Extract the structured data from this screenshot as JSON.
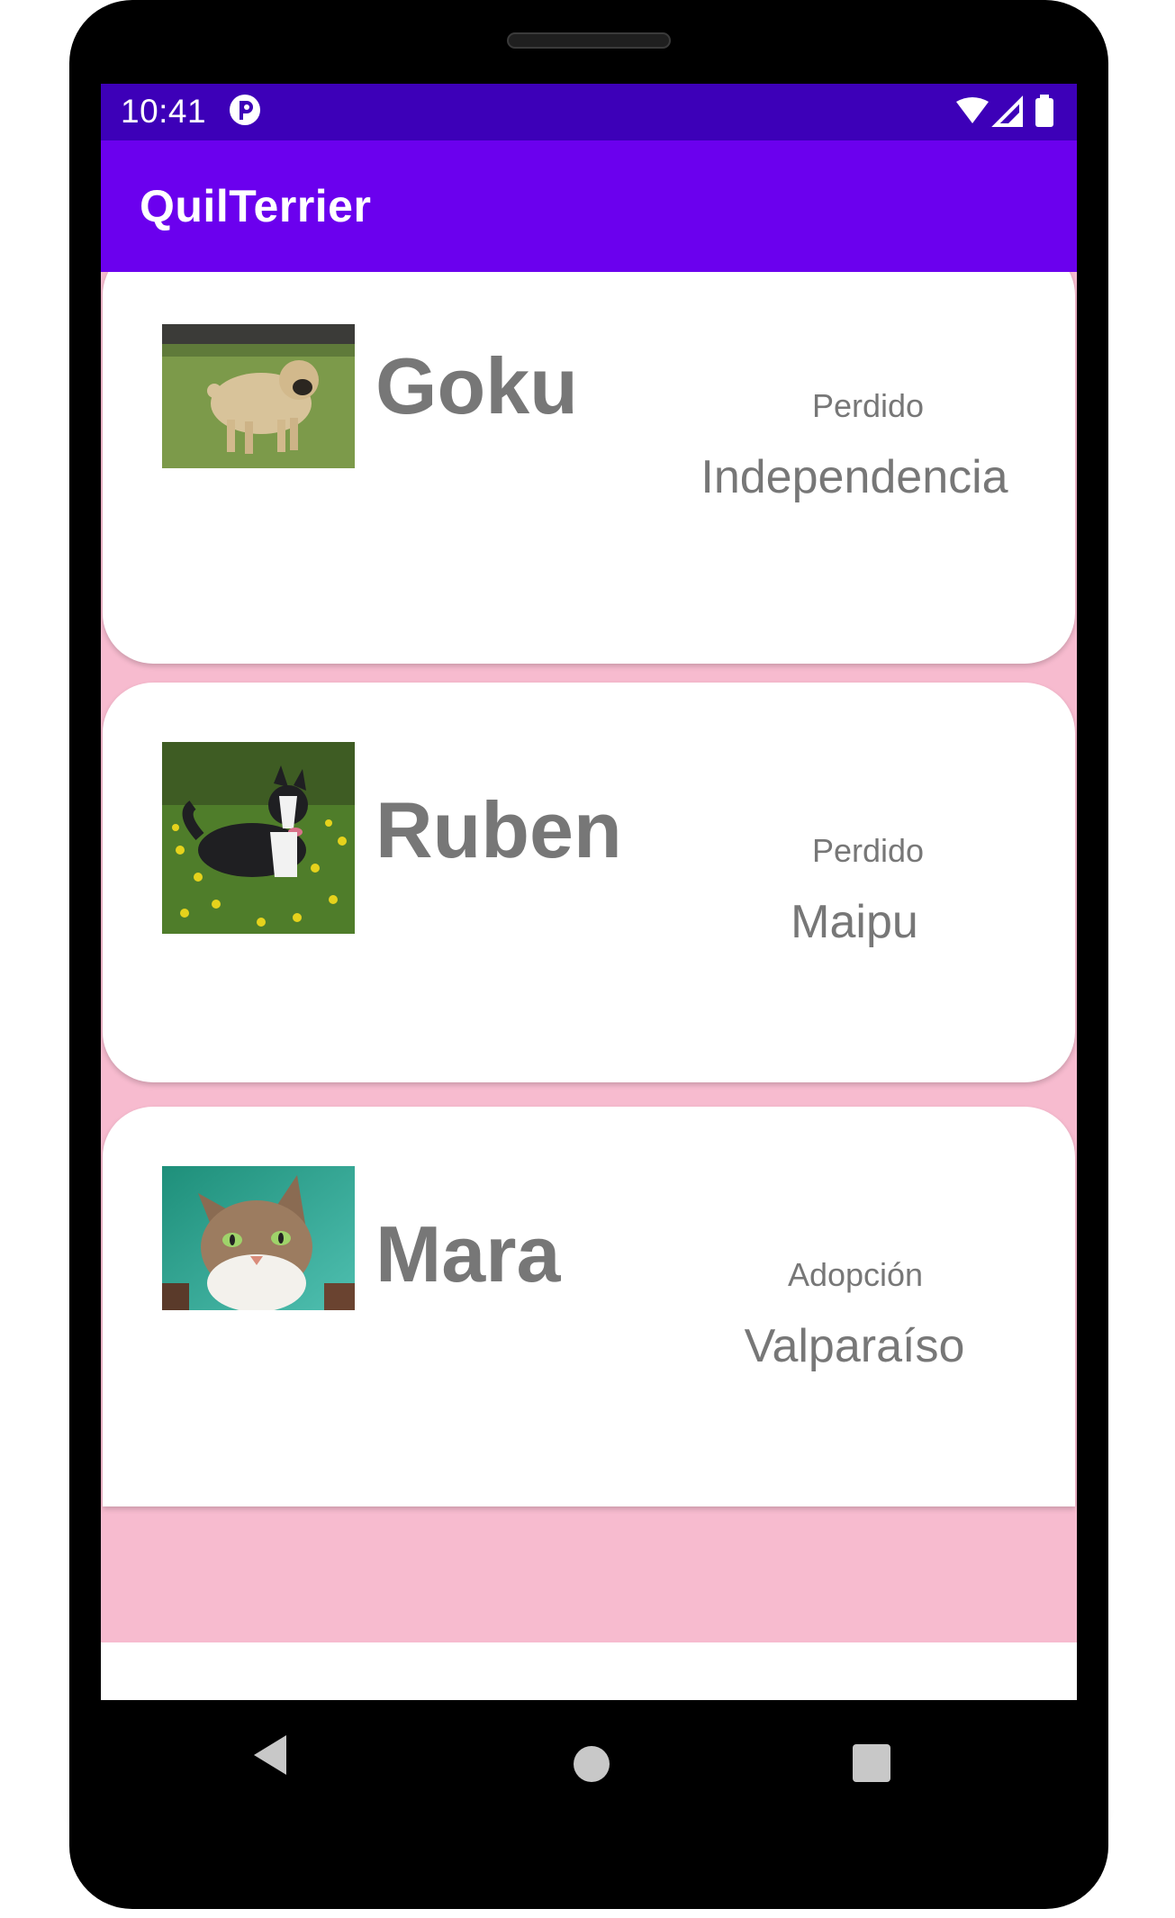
{
  "status_bar": {
    "time": "10:41"
  },
  "app_bar": {
    "title": "QuilTerrier"
  },
  "pets": [
    {
      "name": "Goku",
      "status": "Perdido",
      "location": "Independencia",
      "photo": "pug-dog-photo"
    },
    {
      "name": "Ruben",
      "status": "Perdido",
      "location": "Maipu",
      "photo": "border-collie-dog-photo"
    },
    {
      "name": "Mara",
      "status": "Adopción",
      "location": "Valparaíso",
      "photo": "tabby-cat-photo"
    }
  ],
  "colors": {
    "status_bar": "#3d00b8",
    "app_bar": "#6b00ee",
    "list_background": "#f7bbcf",
    "card": "#ffffff",
    "text": "#777777"
  },
  "nav": [
    "back-icon",
    "home-icon",
    "recents-icon"
  ]
}
